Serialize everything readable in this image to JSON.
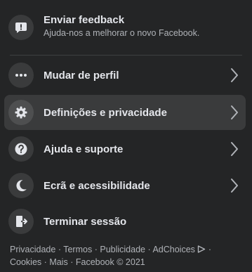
{
  "feedback": {
    "title": "Enviar feedback",
    "subtitle": "Ajuda-nos a melhorar o novo Facebook.",
    "icon": "feedback-exclamation-icon"
  },
  "menu": {
    "switch_profile": {
      "label": "Mudar de perfil",
      "icon": "more-dots-icon"
    },
    "settings": {
      "label": "Definições e privacidade",
      "icon": "gear-icon"
    },
    "help": {
      "label": "Ajuda e suporte",
      "icon": "question-icon"
    },
    "display": {
      "label": "Ecrã e acessibilidade",
      "icon": "moon-icon"
    },
    "logout": {
      "label": "Terminar sessão",
      "icon": "logout-door-icon"
    }
  },
  "footer": {
    "privacy": "Privacidade",
    "terms": "Termos",
    "advertising": "Publicidade",
    "adchoices": "AdChoices",
    "cookies": "Cookies",
    "more": "Mais",
    "copyright": "Facebook © 2021",
    "separator": "·"
  },
  "colors": {
    "background": "#242526",
    "hover": "#3a3b3c",
    "primary_text": "#e4e6eb",
    "secondary_text": "#b0b3b8"
  }
}
